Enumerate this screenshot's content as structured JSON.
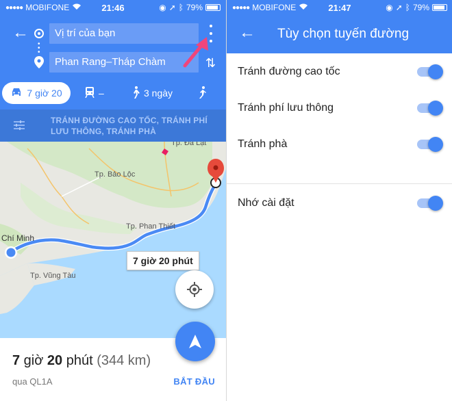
{
  "left": {
    "status": {
      "carrier": "MOBIFONE",
      "time": "21:46",
      "battery": "79%"
    },
    "origin": "Vị trí của bạn",
    "destination": "Phan Rang–Tháp Chàm",
    "modes": {
      "drive": "7 giờ 20",
      "transit": "–",
      "walk": "3 ngày"
    },
    "avoid_text": "TRÁNH ĐƯỜNG CAO TỐC, TRÁNH PHÍ LƯU THÔNG, TRÁNH PHÀ",
    "map": {
      "labels": {
        "da_lat": "Tp. Đà Lạt",
        "bao_loc": "Tp. Bảo Lộc",
        "phan_thiet": "Tp. Phan Thiết",
        "chi_minh": "Chí Minh",
        "vung_tau": "Tp. Vũng Tàu"
      },
      "time_bubble": "7 giờ 20 phút"
    },
    "summary": {
      "hours": "7",
      "hours_unit": " giờ ",
      "minutes": "20",
      "minutes_unit": " phút ",
      "distance": "(344 km)",
      "via": "qua QL1A",
      "start": "BẮT ĐẦU"
    },
    "colors": {
      "primary": "#4285f4",
      "accent_arrow": "#f0457c",
      "route": "#4a8af4"
    }
  },
  "right": {
    "status": {
      "carrier": "MOBIFONE",
      "time": "21:47",
      "battery": "79%"
    },
    "title": "Tùy chọn tuyến đường",
    "options": [
      {
        "label": "Tránh đường cao tốc",
        "on": true
      },
      {
        "label": "Tránh phí lưu thông",
        "on": true
      },
      {
        "label": "Tránh phà",
        "on": true
      }
    ],
    "remember": {
      "label": "Nhớ cài đặt",
      "on": true
    }
  }
}
